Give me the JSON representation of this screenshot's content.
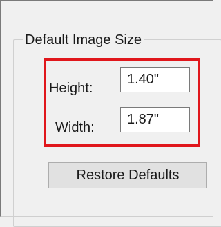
{
  "group": {
    "title": "Default Image Size"
  },
  "height_field": {
    "label": "Height:",
    "value": "1.40\""
  },
  "width_field": {
    "label": "Width:",
    "value": "1.87\""
  },
  "restore_button": {
    "label": "Restore Defaults"
  },
  "colors": {
    "highlight": "#e0161b",
    "background": "#f0f0f0"
  }
}
